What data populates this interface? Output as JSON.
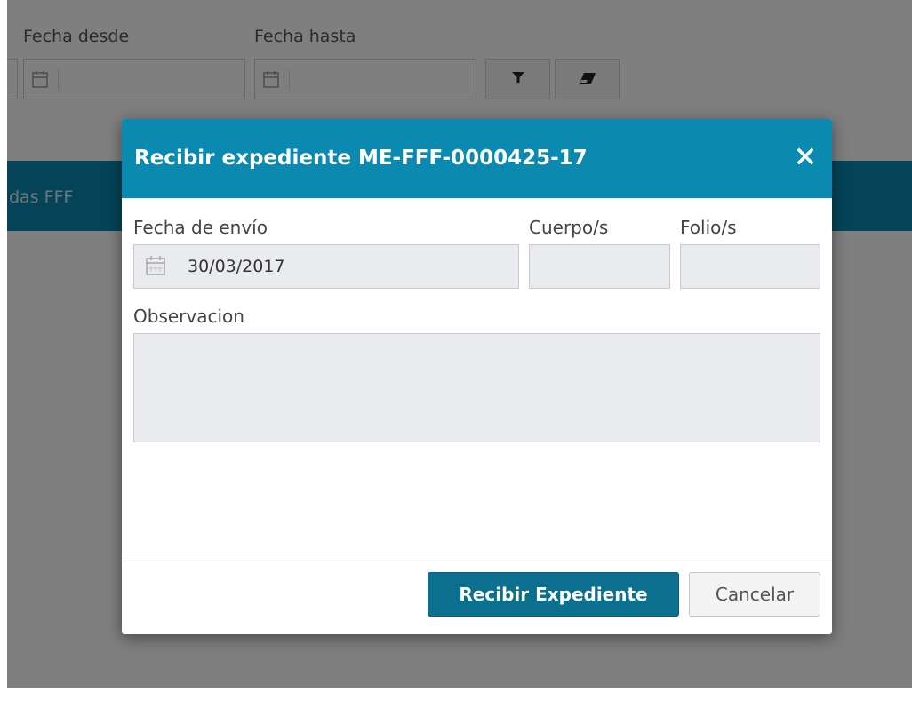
{
  "filters": {
    "date_from_label": "Fecha desde",
    "date_to_label": "Fecha hasta",
    "filter_icon": "filter-icon",
    "clear_icon": "eraser-icon"
  },
  "background_band": {
    "text": "das FFF"
  },
  "modal": {
    "title": "Recibir expediente ME-FFF-0000425-17",
    "close_icon": "close-icon",
    "send_date_label": "Fecha de envío",
    "send_date_value": "30/03/2017",
    "calendar_icon": "calendar-icon",
    "bodies_label": "Cuerpo/s",
    "bodies_value": "",
    "folios_label": "Folio/s",
    "folios_value": "",
    "observation_label": "Observacion",
    "observation_value": "",
    "receive_button": "Recibir Expediente",
    "cancel_button": "Cancelar"
  },
  "colors": {
    "header": "#0a89b1",
    "primary_button": "#0b6f8e",
    "overlay": "rgba(0,0,0,0.5)"
  }
}
